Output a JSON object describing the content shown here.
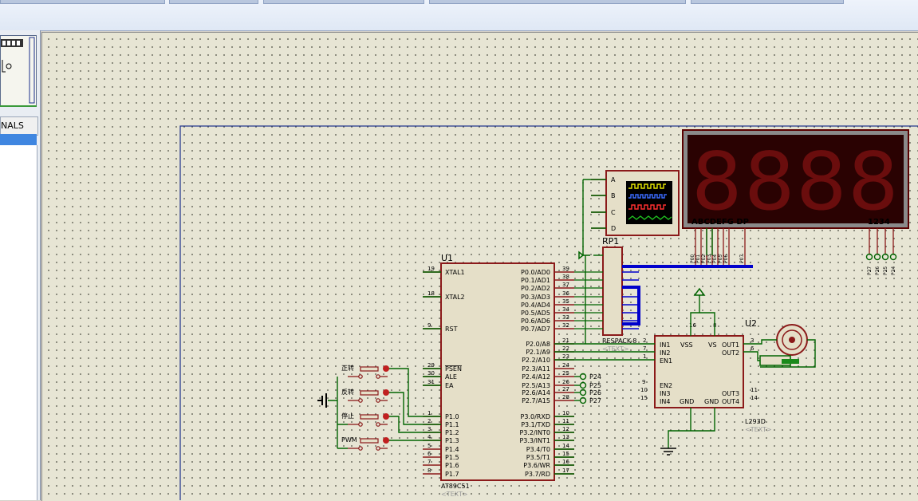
{
  "sidebar": {
    "terminals_label": "NALS"
  },
  "schematic": {
    "u1": {
      "ref": "U1",
      "part": "AT89C51",
      "text": "<TEXT>",
      "left_pins": [
        {
          "num": "19",
          "name": "XTAL1"
        },
        {
          "num": "18",
          "name": "XTAL2"
        },
        {
          "num": "9",
          "name": "RST"
        },
        {
          "num": "29",
          "name": "PSEN"
        },
        {
          "num": "30",
          "name": "ALE"
        },
        {
          "num": "31",
          "name": "EA"
        },
        {
          "num": "1",
          "name": "P1.0"
        },
        {
          "num": "2",
          "name": "P1.1"
        },
        {
          "num": "3",
          "name": "P1.2"
        },
        {
          "num": "4",
          "name": "P1.3"
        },
        {
          "num": "5",
          "name": "P1.4"
        },
        {
          "num": "6",
          "name": "P1.5"
        },
        {
          "num": "7",
          "name": "P1.6"
        },
        {
          "num": "8",
          "name": "P1.7"
        }
      ],
      "right_pins": [
        {
          "num": "39",
          "name": "P0.0/AD0"
        },
        {
          "num": "38",
          "name": "P0.1/AD1"
        },
        {
          "num": "37",
          "name": "P0.2/AD2"
        },
        {
          "num": "36",
          "name": "P0.3/AD3"
        },
        {
          "num": "35",
          "name": "P0.4/AD4"
        },
        {
          "num": "34",
          "name": "P0.5/AD5"
        },
        {
          "num": "33",
          "name": "P0.6/AD6"
        },
        {
          "num": "32",
          "name": "P0.7/AD7"
        },
        {
          "num": "21",
          "name": "P2.0/A8"
        },
        {
          "num": "22",
          "name": "P2.1/A9"
        },
        {
          "num": "23",
          "name": "P2.2/A10"
        },
        {
          "num": "24",
          "name": "P2.3/A11"
        },
        {
          "num": "25",
          "name": "P2.4/A12"
        },
        {
          "num": "26",
          "name": "P2.5/A13"
        },
        {
          "num": "27",
          "name": "P2.6/A14"
        },
        {
          "num": "28",
          "name": "P2.7/A15"
        },
        {
          "num": "10",
          "name": "P3.0/RXD"
        },
        {
          "num": "11",
          "name": "P3.1/TXD"
        },
        {
          "num": "12",
          "name": "P3.2/INT0"
        },
        {
          "num": "13",
          "name": "P3.3/INT1"
        },
        {
          "num": "14",
          "name": "P3.4/T0"
        },
        {
          "num": "15",
          "name": "P3.5/T1"
        },
        {
          "num": "16",
          "name": "P3.6/WR"
        },
        {
          "num": "17",
          "name": "P3.7/RD"
        }
      ],
      "p2_terminals": [
        "P24",
        "P25",
        "P26",
        "P27"
      ]
    },
    "u2": {
      "ref": "U2",
      "part": "L293D",
      "text": "<TEXT>",
      "pins": {
        "in1": "IN1",
        "in2": "IN2",
        "en1": "EN1",
        "en2": "EN2",
        "in3": "IN3",
        "in4": "IN4",
        "vss": "VSS",
        "vs": "VS",
        "gnd1": "GND",
        "gnd2": "GND",
        "out1": "OUT1",
        "out2": "OUT2",
        "out3": "OUT3",
        "out4": "OUT4"
      },
      "pin_numbers": {
        "in1": "2",
        "in2": "7",
        "en1": "1",
        "en2": "9",
        "in3": "10",
        "in4": "15",
        "vss": "16",
        "vs": "8",
        "out1": "3",
        "out2": "6",
        "out3": "11",
        "out4": "14"
      }
    },
    "rp1": {
      "ref": "RP1",
      "part": "RESPACK-8",
      "text": "<TEXT>"
    },
    "scope": {
      "channels": [
        "A",
        "B",
        "C",
        "D"
      ]
    },
    "display": {
      "digits": [
        "8",
        "8",
        "8",
        "8"
      ],
      "segment_label": "ABCDEFG DP",
      "digit_label": "1234",
      "segment_pins": [
        "P00",
        "P01",
        "P02",
        "P03",
        "P04",
        "P05",
        "P06",
        "P07"
      ],
      "digit_pins": [
        "P27",
        "P26",
        "P25",
        "P24"
      ]
    },
    "buttons": [
      {
        "label": "正转"
      },
      {
        "label": "反转"
      },
      {
        "label": "停止"
      },
      {
        "label": "PWM"
      }
    ],
    "colors": {
      "wire": "#006400",
      "component": "#8b1a1a",
      "bus": "#0000cc",
      "sheet_border": "#1c2f8c",
      "display_bg": "#2a0202",
      "segment_off": "#6a0d0d"
    }
  }
}
